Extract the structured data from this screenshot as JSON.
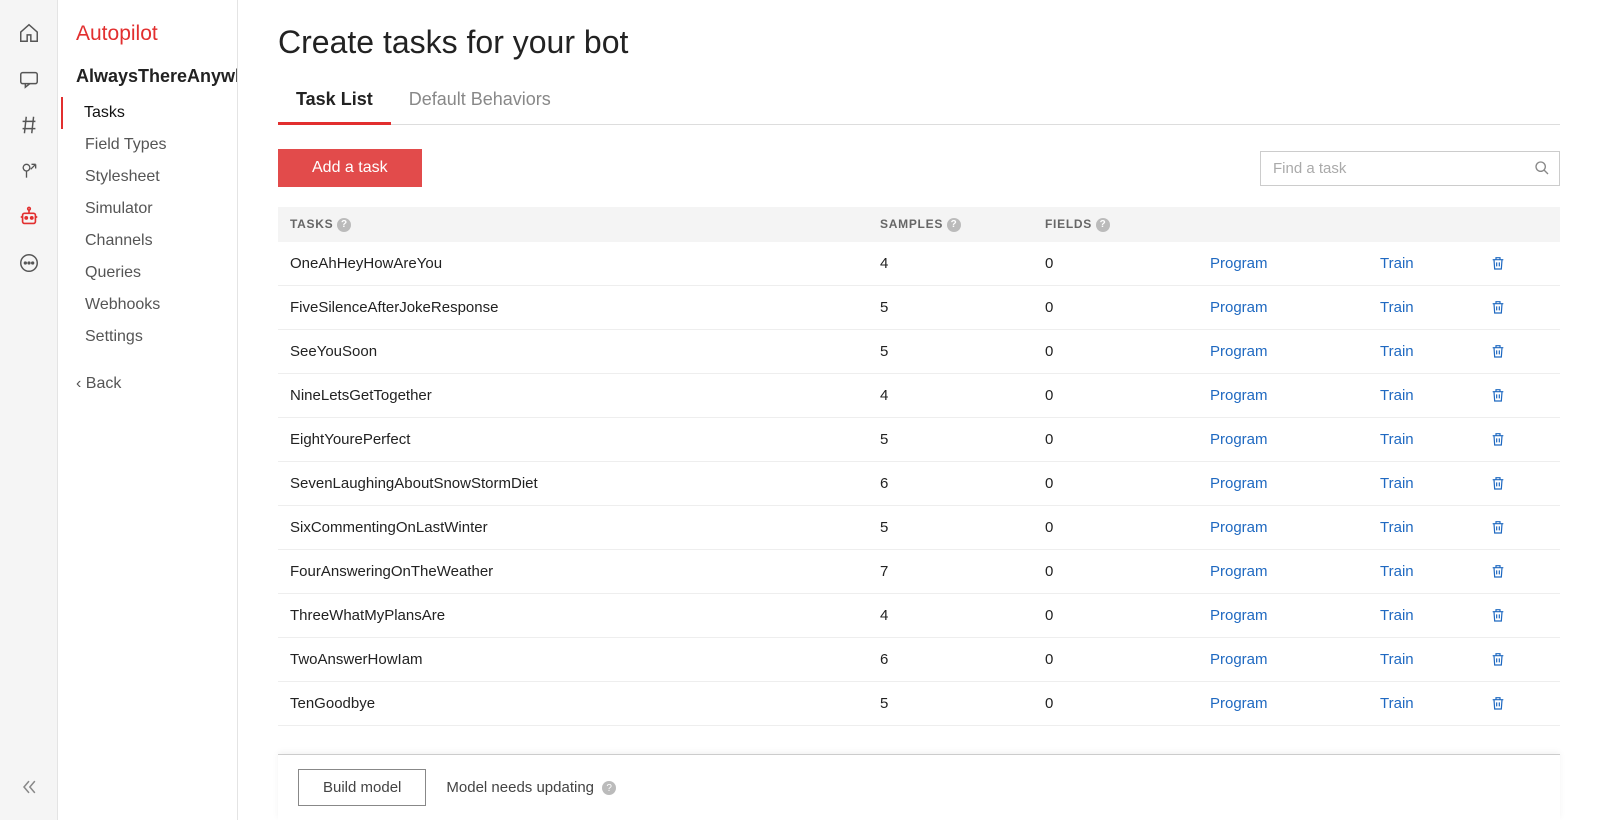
{
  "brand": "Autopilot",
  "breadcrumb": "AlwaysThereAnywh",
  "nav": {
    "items": [
      {
        "label": "Tasks",
        "active": true
      },
      {
        "label": "Field Types"
      },
      {
        "label": "Stylesheet"
      },
      {
        "label": "Simulator"
      },
      {
        "label": "Channels"
      },
      {
        "label": "Queries"
      },
      {
        "label": "Webhooks"
      },
      {
        "label": "Settings"
      }
    ],
    "back": "Back"
  },
  "page": {
    "title": "Create tasks for your bot",
    "tabs": [
      {
        "label": "Task List",
        "active": true
      },
      {
        "label": "Default Behaviors"
      }
    ],
    "add_button": "Add a task",
    "search_placeholder": "Find a task"
  },
  "table": {
    "headers": {
      "tasks": "TASKS",
      "samples": "SAMPLES",
      "fields": "FIELDS"
    },
    "program_label": "Program",
    "train_label": "Train",
    "rows": [
      {
        "name": "OneAhHeyHowAreYou",
        "samples": "4",
        "fields": "0"
      },
      {
        "name": "FiveSilenceAfterJokeResponse",
        "samples": "5",
        "fields": "0"
      },
      {
        "name": "SeeYouSoon",
        "samples": "5",
        "fields": "0"
      },
      {
        "name": "NineLetsGetTogether",
        "samples": "4",
        "fields": "0"
      },
      {
        "name": "EightYourePerfect",
        "samples": "5",
        "fields": "0"
      },
      {
        "name": "SevenLaughingAboutSnowStormDiet",
        "samples": "6",
        "fields": "0"
      },
      {
        "name": "SixCommentingOnLastWinter",
        "samples": "5",
        "fields": "0"
      },
      {
        "name": "FourAnsweringOnTheWeather",
        "samples": "7",
        "fields": "0"
      },
      {
        "name": "ThreeWhatMyPlansAre",
        "samples": "4",
        "fields": "0"
      },
      {
        "name": "TwoAnswerHowIam",
        "samples": "6",
        "fields": "0"
      },
      {
        "name": "TenGoodbye",
        "samples": "5",
        "fields": "0"
      }
    ]
  },
  "footer": {
    "build_button": "Build model",
    "status": "Model needs updating"
  }
}
